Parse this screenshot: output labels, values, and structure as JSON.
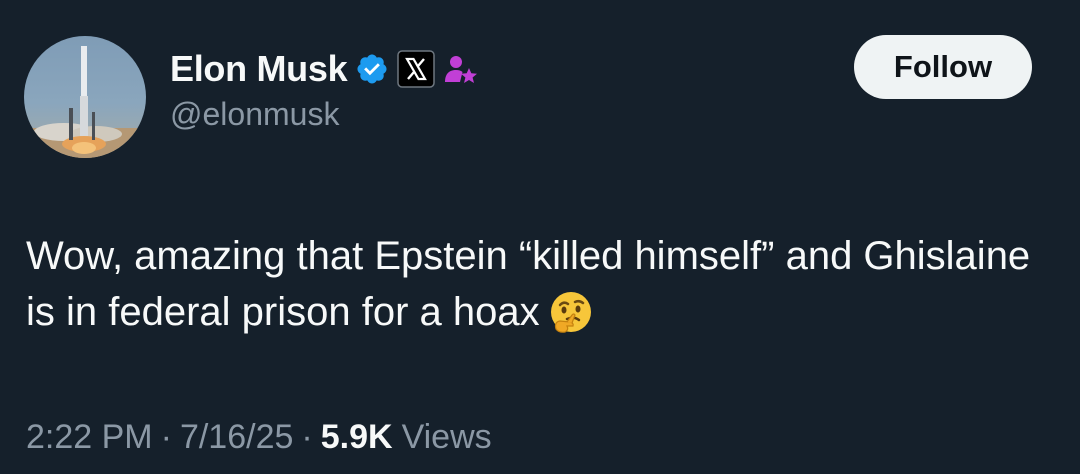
{
  "author": {
    "display_name": "Elon Musk",
    "handle": "@elonmusk",
    "badges": [
      "verified-badge-icon",
      "x-affiliate-badge-icon",
      "person-star-badge-icon"
    ]
  },
  "follow_button": {
    "label": "Follow"
  },
  "tweet": {
    "text": "Wow, amazing that Epstein “killed himself” and Ghislaine is in federal prison for a hoax",
    "emoji": "thinking-face-icon"
  },
  "meta": {
    "time": "2:22 PM",
    "separator": "·",
    "date": "7/16/25",
    "views_count": "5.9K",
    "views_label": "Views"
  },
  "colors": {
    "background": "#15202b",
    "text_primary": "#f7f9f9",
    "text_secondary": "#8b98a5",
    "verified_blue": "#1d9bf0",
    "follow_bg": "#eff3f4"
  }
}
